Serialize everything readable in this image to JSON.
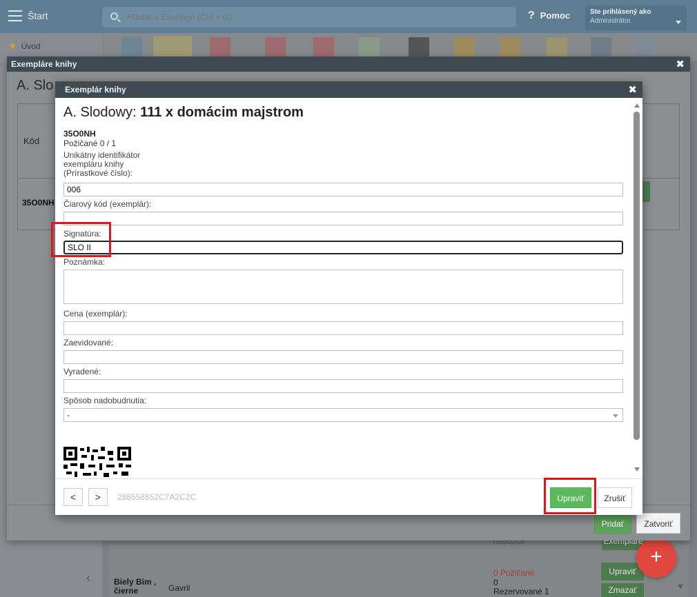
{
  "topbar": {
    "start_label": "Štart",
    "search_placeholder": "Hľadať v EduPage (Ctrl + G)",
    "help_label": "Pomoc",
    "user_line1": "Ste prihlásený ako",
    "user_line2": "Administrátor"
  },
  "leftnav": {
    "uvod_label": "Úvod"
  },
  "outer_dialog": {
    "title": "Exempláre knihy",
    "heading": "A. Slo",
    "kod_header": "Kód",
    "row_code": "35O0NH",
    "pridat_label": "Pridať",
    "zatvorit_label": "Zatvoriť"
  },
  "background_list": {
    "dispozicii": "dispozícii",
    "name": "Biely Bim , čierne",
    "author": "Gavril",
    "pozicane": "0 Požičané",
    "zero": "0",
    "rezervovane": "Rezervované  1",
    "btn_exemplare": "Exempláre",
    "btn_upravit": "Upraviť",
    "btn_zmazat": "Zmazať",
    "fab_label": "+"
  },
  "dialog": {
    "title": "Exemplár knihy",
    "book_author": "A. Slodowy:",
    "book_title": "111 x domácim majstrom",
    "code": "35O0NH",
    "borrowed": "Požičané 0 / 1",
    "id_label_1": "Unikátny identifikátor",
    "id_label_2": "exempláru knihy",
    "id_label_3": "(Prírastkové číslo):",
    "id_value": "006",
    "barcode_label": "Čiarový kód (exemplár):",
    "barcode_value": "",
    "signatura_label": "Signatúra:",
    "signatura_value": "SLO II",
    "poznamka_label": "Poznámka:",
    "poznamka_value": "",
    "cena_label": "Cena (exemplár):",
    "cena_value": "",
    "zaevidovane_label": "Zaevidované:",
    "zaevidovane_value": "",
    "vyradene_label": "Vyradené:",
    "vyradene_value": "",
    "sposob_label": "Spôsob nadobudnutia:",
    "sposob_value": "-",
    "prev_label": "<",
    "next_label": ">",
    "hash": "288558852C7A2C2C",
    "upravit_label": "Upraviť",
    "zrusit_label": "Zrušiť"
  },
  "colors": {
    "header_dark": "#3f4a52",
    "accent_green": "#5cb85c",
    "highlight_red": "#e0141a",
    "fab_red": "#e0473e"
  },
  "icons": [
    "hamburger-icon",
    "search-icon",
    "help-icon",
    "star-icon",
    "close-icon",
    "qr-code-icon"
  ]
}
